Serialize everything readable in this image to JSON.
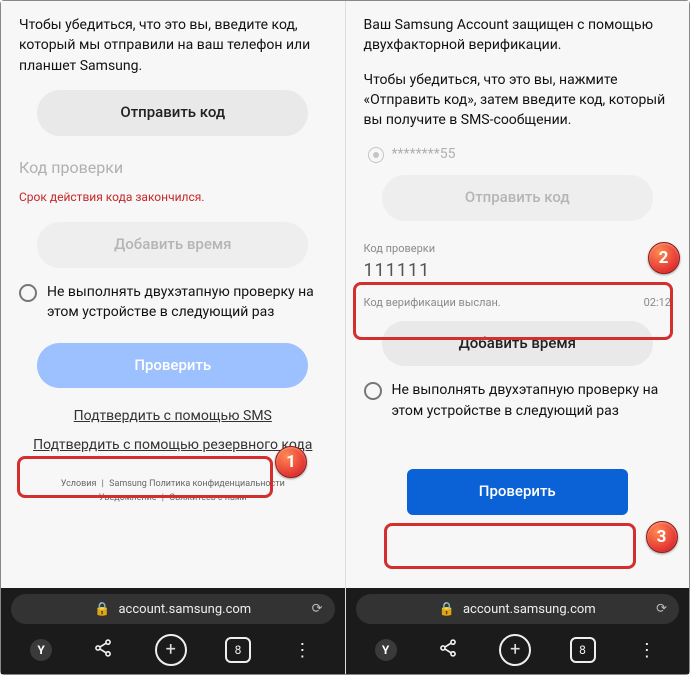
{
  "left": {
    "intro": "Чтобы убедиться, что это вы, введите код, который мы отправили на ваш телефон или планшет Samsung.",
    "send_code": "Отправить код",
    "field_placeholder": "Код проверки",
    "error": "Срок действия кода закончился.",
    "add_time": "Добавить время",
    "skip_label": "Не выполнять двухэтапную проверку на этом устройстве в следующий раз",
    "verify": "Проверить",
    "link_sms": "Подтвердить с помощью SMS",
    "link_backup": "Подтвердить с помощью резервного кода",
    "footer": {
      "a": "Условия",
      "b": "Samsung Политика конфиденциальности",
      "c": "Уведомление",
      "d": "Свяжитесь с нами"
    }
  },
  "right": {
    "intro": "Ваш Samsung Account защищен с помощью двухфакторной верификации.",
    "intro2": "Чтобы убедиться, что это вы, нажмите «Отправить код», затем введите код, который вы получите в SMS-сообщении.",
    "masked": "********55",
    "send_code": "Отправить код",
    "field_label": "Код проверки",
    "field_value": "111111",
    "status": "Код верификации выслан.",
    "timer": "02:12",
    "add_time": "Добавить время",
    "skip_label": "Не выполнять двухэтапную проверку на этом устройстве в следующий раз",
    "verify": "Проверить"
  },
  "browser": {
    "url": "account.samsung.com",
    "tab_count": "8"
  },
  "annotations": {
    "b1": "1",
    "b2": "2",
    "b3": "3"
  }
}
